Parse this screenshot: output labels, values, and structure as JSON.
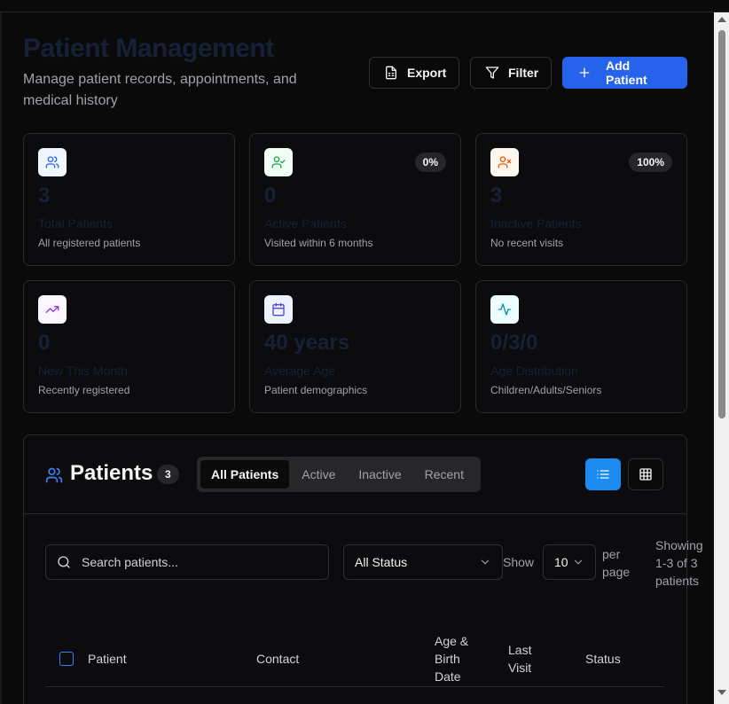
{
  "header": {
    "title": "Patient Management",
    "subtitle": "Manage patient records, appointments, and medical history",
    "export_label": "Export",
    "filter_label": "Filter",
    "add_label": "Add Patient"
  },
  "stats": [
    {
      "value": "3",
      "label": "Total Patients",
      "desc": "All registered patients",
      "badge": "",
      "icon": "users-icon",
      "color": "#2563eb"
    },
    {
      "value": "0",
      "label": "Active Patients",
      "desc": "Visited within 6 months",
      "badge": "0%",
      "icon": "user-check-icon",
      "color": "#16a34a"
    },
    {
      "value": "3",
      "label": "Inactive Patients",
      "desc": "No recent visits",
      "badge": "100%",
      "icon": "user-x-icon",
      "color": "#ea580c"
    },
    {
      "value": "0",
      "label": "New This Month",
      "desc": "Recently registered",
      "badge": "",
      "icon": "trending-up-icon",
      "color": "#9333ea"
    },
    {
      "value": "40 years",
      "label": "Average Age",
      "desc": "Patient demographics",
      "badge": "",
      "icon": "calendar-icon",
      "color": "#4f46e5"
    },
    {
      "value": "0/3/0",
      "label": "Age Distribution",
      "desc": "Children/Adults/Seniors",
      "badge": "",
      "icon": "activity-icon",
      "color": "#0891b2"
    }
  ],
  "panel": {
    "title": "Patients",
    "count": "3",
    "tabs": [
      "All Patients",
      "Active",
      "Inactive",
      "Recent"
    ],
    "active_tab": "All Patients",
    "search_placeholder": "Search patients...",
    "status_value": "All Status",
    "show_label": "Show",
    "per_page_value": "10",
    "per_page_label": "per page",
    "showing_text": "Showing 1-3 of 3 patients",
    "columns": [
      "Patient",
      "Contact",
      "Age & Birth Date",
      "Last Visit",
      "Status"
    ]
  }
}
